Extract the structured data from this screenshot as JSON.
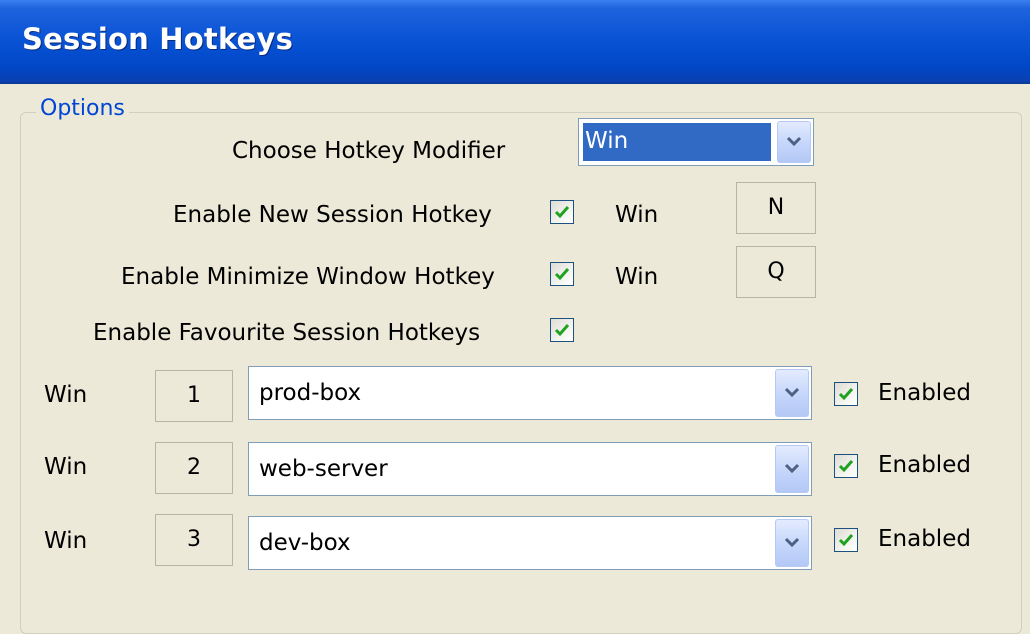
{
  "window": {
    "title": "Session Hotkeys"
  },
  "options": {
    "legend": "Options",
    "modifier_label": "Choose Hotkey Modifier",
    "modifier_value": "Win",
    "new_session": {
      "label": "Enable New Session Hotkey",
      "checked": true,
      "modifier": "Win",
      "key": "N"
    },
    "minimize": {
      "label": "Enable Minimize Window Hotkey",
      "checked": true,
      "modifier": "Win",
      "key": "Q"
    },
    "favourites": {
      "label": "Enable Favourite Session Hotkeys",
      "checked": true
    },
    "rows": [
      {
        "modifier": "Win",
        "key": "1",
        "session": "prod-box",
        "enabled_label": "Enabled",
        "enabled": true
      },
      {
        "modifier": "Win",
        "key": "2",
        "session": "web-server",
        "enabled_label": "Enabled",
        "enabled": true
      },
      {
        "modifier": "Win",
        "key": "3",
        "session": "dev-box",
        "enabled_label": "Enabled",
        "enabled": true
      }
    ]
  },
  "colors": {
    "titlebar": "#0a54d6",
    "legend": "#0046d5",
    "check": "#21a121",
    "selection": "#316ac5"
  }
}
